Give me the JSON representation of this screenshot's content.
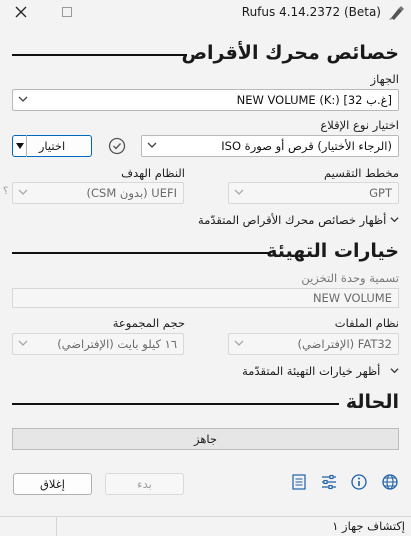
{
  "window": {
    "title": "Rufus 4.14.2372 (Beta)"
  },
  "drive_properties": {
    "heading": "خصائص محرك الأقراص",
    "device_label": "الجهاز",
    "device_value": "NEW VOLUME (K:) [32 غ.ب]",
    "boot_selection_label": "اختيار نوع الإقلاع",
    "boot_selection_value": "(الرجاء الأختيار) قرص أو صورة ISO",
    "select_button": "اختيار",
    "partition_scheme_label": "مخطط التقسيم",
    "partition_scheme_value": "GPT",
    "target_system_label": "النظام الهدف",
    "target_system_value": "UEFI (بدون CSM)",
    "help_mark": "؟",
    "advanced_toggle": "أظهار خصائص محرك الأقراص المتقدّمة"
  },
  "format_options": {
    "heading": "خيارات التهيئة",
    "volume_label_label": "تسمية وحدة التخزين",
    "volume_label_value": "NEW VOLUME",
    "file_system_label": "نظام الملفات",
    "file_system_value": "FAT32 (الإفتراضي)",
    "cluster_size_label": "حجم المجموعة",
    "cluster_size_value": "١٦ كيلو بايت (الإفتراضي)",
    "advanced_toggle": "أظهر خيارات التهيئة المتقدّمة"
  },
  "status": {
    "heading": "الحالة",
    "progress_text": "جاهز",
    "progress_fraction": 0
  },
  "actions": {
    "start_button": "بدء",
    "close_button": "إغلاق"
  },
  "toolbar_icons": [
    "globe-icon",
    "info-icon",
    "settings-icon",
    "log-icon"
  ],
  "statusbar": {
    "text": "إكتشاف جهاز ١"
  }
}
